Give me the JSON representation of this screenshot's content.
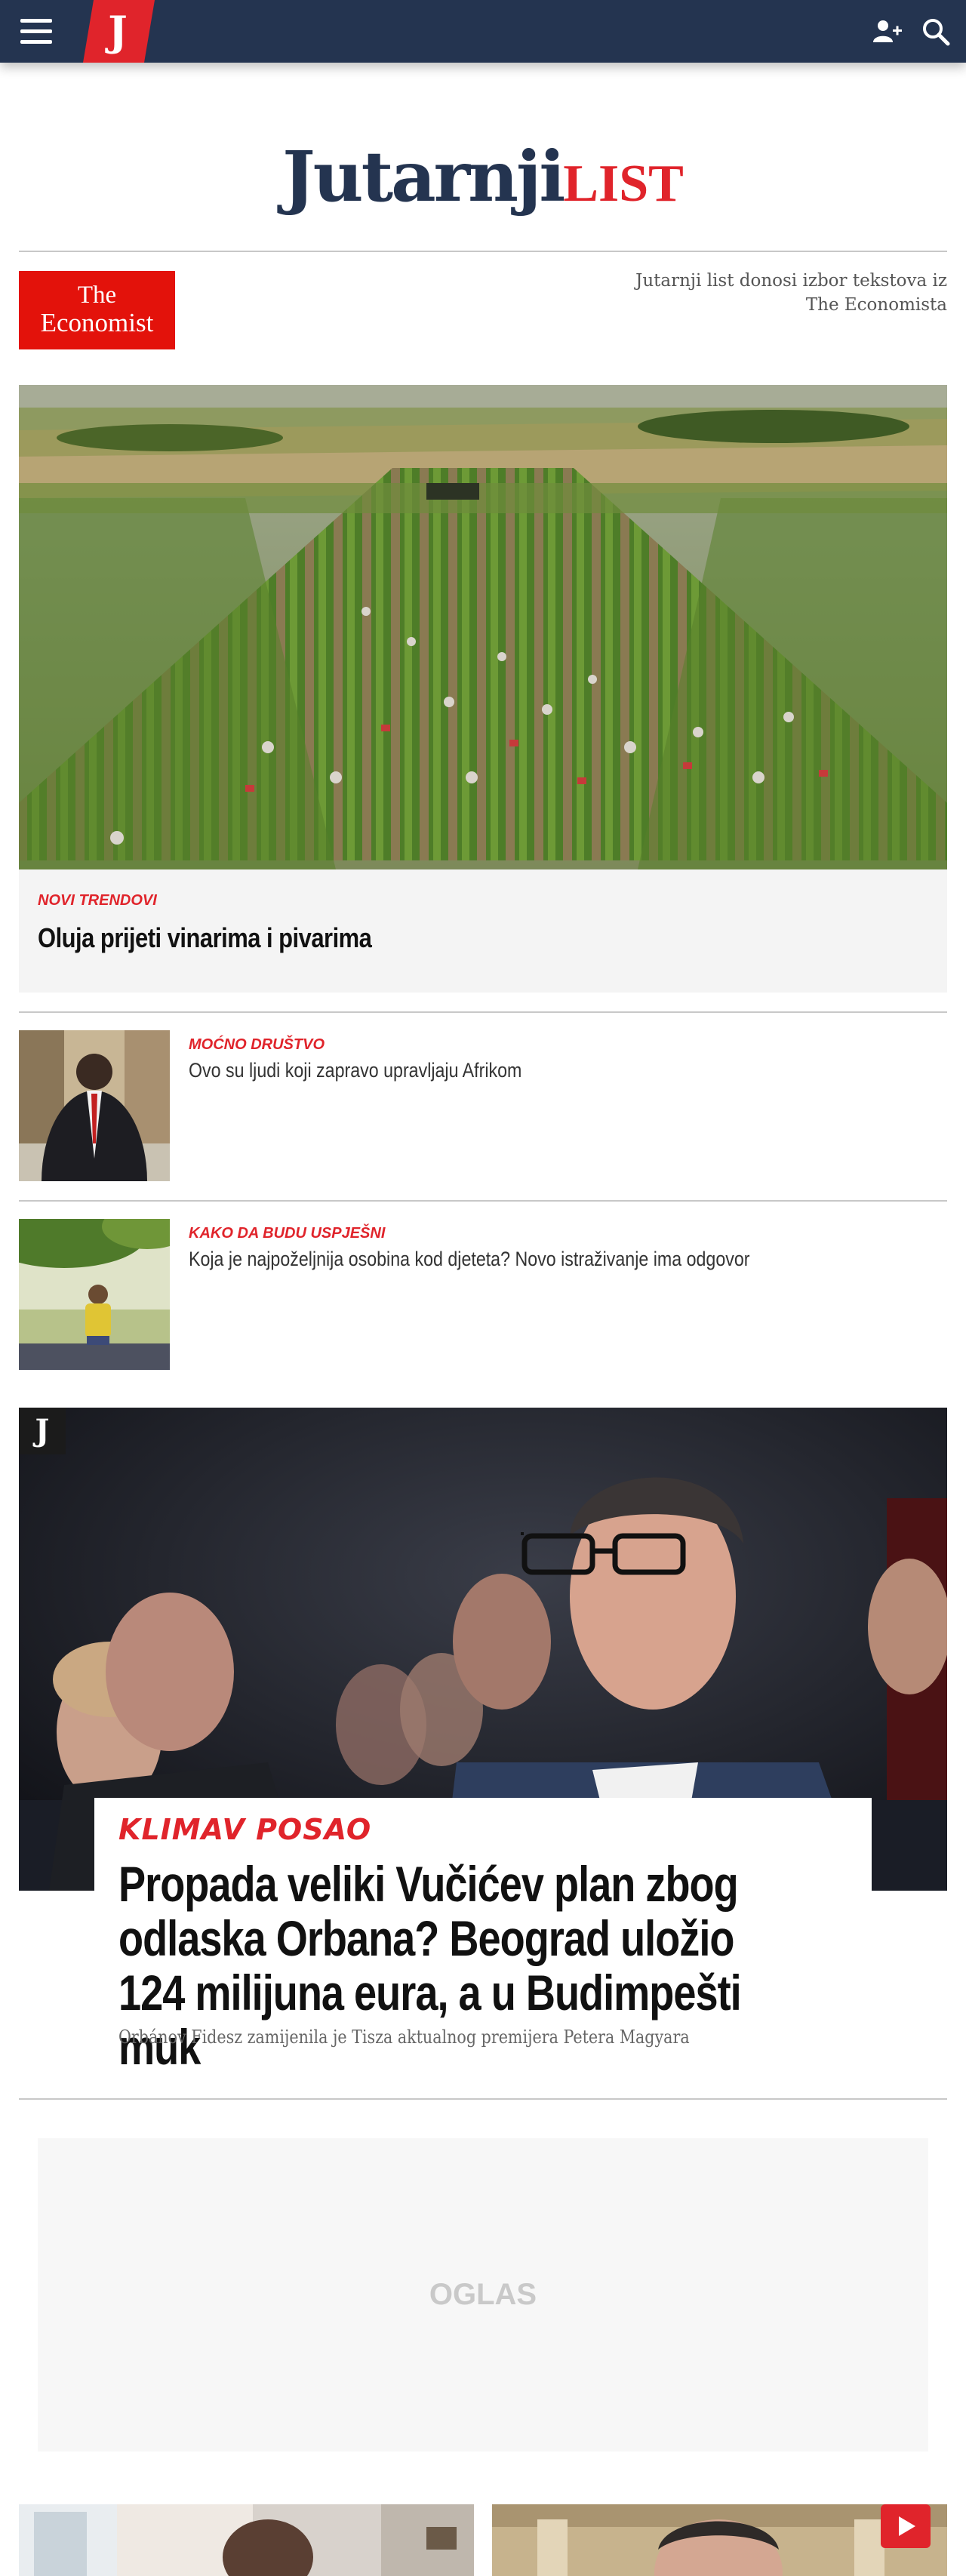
{
  "header": {
    "logo_letter": "J",
    "menu_icon": "hamburger-menu-icon",
    "user_icon": "add-user-icon",
    "search_icon": "search-icon",
    "bg_color": "#243450",
    "accent": "#e0242b"
  },
  "masthead": {
    "brand_main": "Jutarnji",
    "brand_accent": "LIST"
  },
  "partner": {
    "logo_line1": "The",
    "logo_line2": "Economist",
    "description": "Jutarnji list donosi izbor tekstova iz The Economista",
    "logo_color": "#e3120b"
  },
  "hero": {
    "kicker": "NOVI TRENDOVI",
    "title": "Oluja prijeti vinarima i pivarima"
  },
  "articles": [
    {
      "kicker": "MOĆNO DRUŠTVO",
      "title": "Ovo su ljudi koji zapravo upravljaju Afrikom"
    },
    {
      "kicker": "KAKO DA BUDU USPJEŠNI",
      "title": "Koja je najpoželjnija osobina kod djeteta? Novo istraživanje ima odgovor"
    }
  ],
  "feature": {
    "badge": "J",
    "kicker": "KLIMAV POSAO",
    "title": "Propada veliki Vučićev plan zbog odlaska Orbana? Beograd uložio 124 milijuna eura, a u Budimpešti muk",
    "subtitle": "Orbánov Fidesz zamijenila je Tisza aktualnog premijera Petera Magyara"
  },
  "ad": {
    "label": "OGLAS"
  },
  "bottom": {
    "video_icon": "play-icon"
  }
}
